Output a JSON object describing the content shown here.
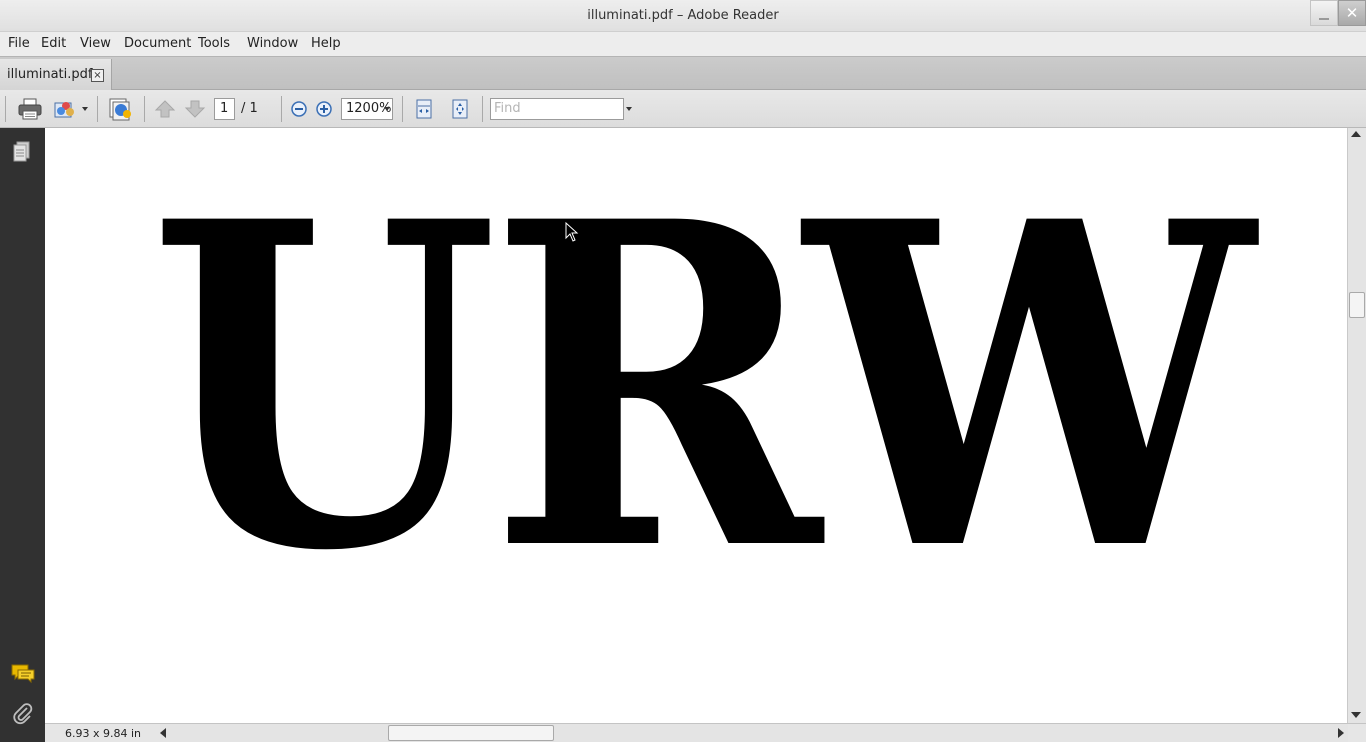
{
  "window": {
    "title": "illuminati.pdf – Adobe Reader",
    "close_glyph": "✕"
  },
  "menu": {
    "items": [
      "File",
      "Edit",
      "View",
      "Document",
      "Tools",
      "Window",
      "Help"
    ]
  },
  "tabs": [
    {
      "label": "illuminati.pdf",
      "close_glyph": "×"
    }
  ],
  "toolbar": {
    "current_page": "1",
    "page_total_label": "/  1",
    "zoom_value": "1200%",
    "find_placeholder": "Find"
  },
  "document": {
    "text": "URW"
  },
  "status": {
    "page_size": "6.93 x 9.84 in"
  },
  "icons": {
    "print": "printer-icon",
    "share": "collaborate-icon",
    "tools": "email-share-icon",
    "prev": "previous-page-icon",
    "next": "next-page-icon",
    "zoom_out": "zoom-out-icon",
    "zoom_in": "zoom-in-icon",
    "fit_width": "fit-width-icon",
    "fit_page": "fit-page-icon",
    "pages": "pages-panel-icon",
    "comments": "comments-icon",
    "attachments": "attachments-icon"
  },
  "colors": {
    "nav_pane": "#313131",
    "accent": "#2a6fb8",
    "comment_icon": "#e8b800"
  }
}
